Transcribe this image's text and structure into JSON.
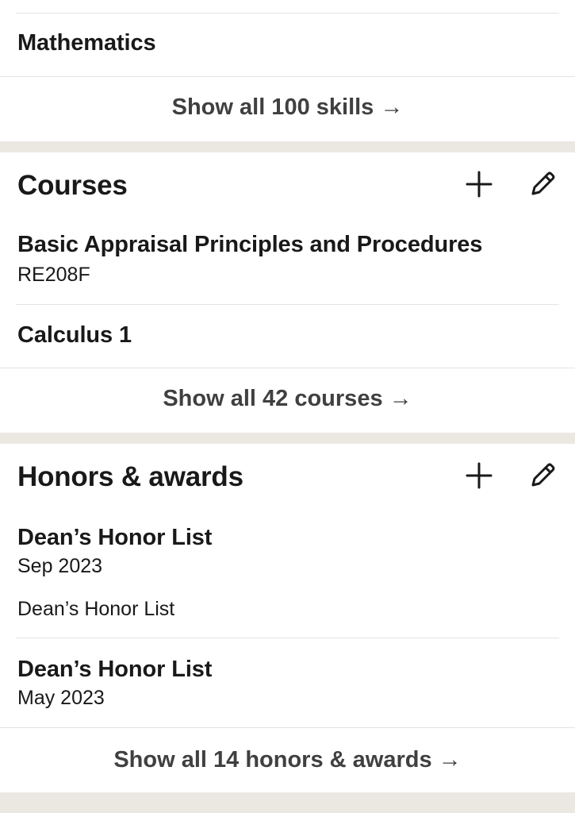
{
  "skills": {
    "last_item": "Mathematics",
    "show_all": "Show all 100 skills →"
  },
  "courses": {
    "title": "Courses",
    "items": [
      {
        "name": "Basic Appraisal Principles and Procedures",
        "code": "RE208F"
      },
      {
        "name": "Calculus 1",
        "code": ""
      }
    ],
    "show_all": "Show all 42 courses →"
  },
  "honors": {
    "title": "Honors & awards",
    "items": [
      {
        "name": "Dean’s Honor List",
        "date": "Sep 2023",
        "description": "Dean’s Honor List"
      },
      {
        "name": "Dean’s Honor List",
        "date": "May 2023",
        "description": ""
      }
    ],
    "show_all": "Show all 14 honors & awards →"
  },
  "icons": {
    "add": "plus-icon",
    "edit": "pencil-icon"
  },
  "colors": {
    "background": "#ebe8e2",
    "card": "#ffffff",
    "text": "#191919",
    "muted": "#404040",
    "divider": "#e3e3e3"
  }
}
